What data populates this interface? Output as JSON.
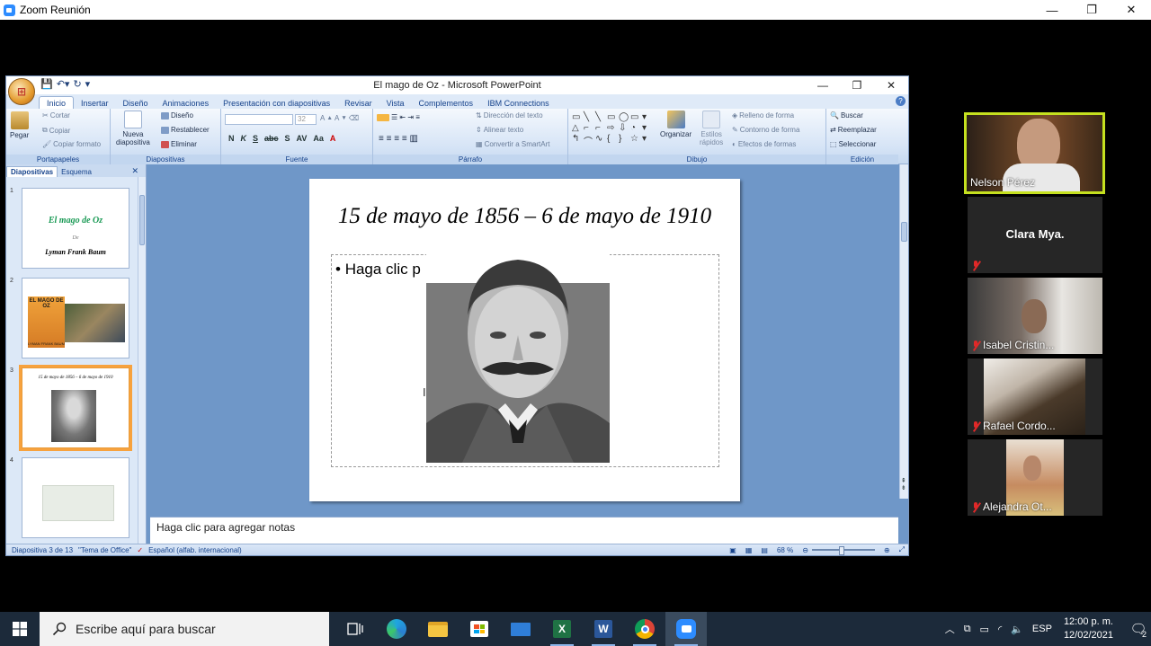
{
  "zoom": {
    "title": "Zoom Reunión",
    "minimize": "—",
    "restore": "❐",
    "close": "✕"
  },
  "ppt": {
    "title": "El mago de Oz - Microsoft PowerPoint",
    "tabs": [
      "Inicio",
      "Insertar",
      "Diseño",
      "Animaciones",
      "Presentación con diapositivas",
      "Revisar",
      "Vista",
      "Complementos",
      "IBM Connections"
    ],
    "ribbon": {
      "portapapeles": {
        "label": "Portapapeles",
        "pegar": "Pegar",
        "cortar": "Cortar",
        "copiar": "Copiar",
        "copiar_formato": "Copiar formato"
      },
      "diapositivas": {
        "label": "Diapositivas",
        "nueva": "Nueva",
        "nueva2": "diapositiva",
        "diseno": "Diseño",
        "restablecer": "Restablecer",
        "eliminar": "Eliminar"
      },
      "fuente": {
        "label": "Fuente",
        "size": "32"
      },
      "parrafo": {
        "label": "Párrafo",
        "direccion": "Dirección del texto",
        "alinear": "Alinear texto",
        "convertir": "Convertir a SmartArt"
      },
      "dibujo": {
        "label": "Dibujo",
        "organizar": "Organizar",
        "estilos": "Estilos",
        "rapidos": "rápidos",
        "relleno": "Relleno de forma",
        "contorno": "Contorno de forma",
        "efectos": "Efectos de formas"
      },
      "edicion": {
        "label": "Edición",
        "buscar": "Buscar",
        "reemplazar": "Reemplazar",
        "seleccionar": "Seleccionar"
      }
    },
    "pane_tabs": {
      "diapositivas": "Diapositivas",
      "esquema": "Esquema"
    },
    "thumbs": [
      {
        "num": "1",
        "title": "El mago de Oz",
        "de": "De",
        "author": "Lyman Frank Baum"
      },
      {
        "num": "2",
        "book": "EL MAGO DE OZ",
        "book_author": "LYMAN FRANK BAUM"
      },
      {
        "num": "3",
        "title": "15 de mayo de 1856 – 6 de mayo de 1910"
      },
      {
        "num": "4"
      }
    ],
    "slide": {
      "title": "15 de mayo de 1856 – 6 de mayo de 1910",
      "bullet": "Haga clic p"
    },
    "notes": "Haga clic para agregar notas",
    "status": {
      "slide": "Diapositiva 3 de 13",
      "theme": "\"Tema de Office\"",
      "lang": "Español (alfab. internacional)",
      "zoom": "68 %"
    }
  },
  "participants": [
    {
      "name": "Nelson Pérez",
      "muted": false
    },
    {
      "name": "Clara Mya.",
      "muted": true
    },
    {
      "name": "Isabel Cristin...",
      "muted": true
    },
    {
      "name": "Rafael Cordo...",
      "muted": true
    },
    {
      "name": "Alejandra Ot...",
      "muted": true
    }
  ],
  "taskbar": {
    "search_placeholder": "Escribe aquí para buscar",
    "lang": "ESP",
    "time": "12:00 p. m.",
    "date": "12/02/2021",
    "notifications": "2"
  },
  "colors": {
    "zoom_blue": "#2d8cff",
    "speaker_border": "#c5e01f",
    "selected_thumb": "#f7a23e",
    "ribbon_text": "#15428b"
  }
}
